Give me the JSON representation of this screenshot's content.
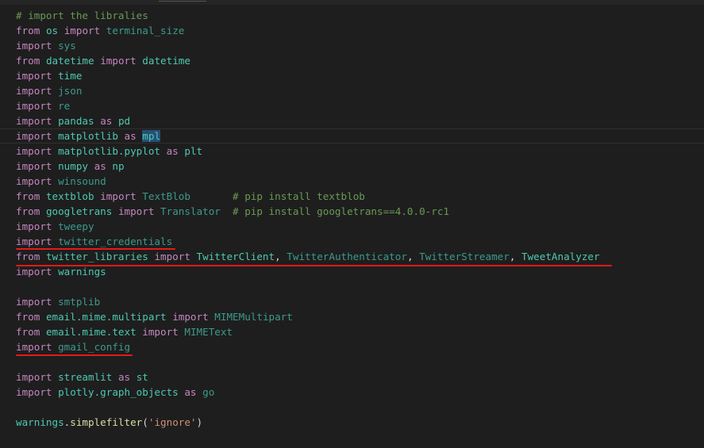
{
  "colors": {
    "background": "#1e1e1e",
    "keyword": "#c586c0",
    "module": "#4ec9b0",
    "unused": "#3c9a8c",
    "comment": "#6a9955",
    "string": "#ce9178",
    "function": "#dcdcaa",
    "variable": "#9cdcfe",
    "annotation": "#e51919"
  },
  "code": {
    "lines": [
      {
        "id": "l1",
        "tokens": [
          {
            "t": "# import the libralies",
            "c": "cm"
          }
        ]
      },
      {
        "id": "l2",
        "tokens": [
          {
            "t": "from",
            "c": "kw"
          },
          {
            "t": " ",
            "c": "plain"
          },
          {
            "t": "os",
            "c": "mod"
          },
          {
            "t": " ",
            "c": "plain"
          },
          {
            "t": "import",
            "c": "kw"
          },
          {
            "t": " ",
            "c": "plain"
          },
          {
            "t": "terminal_size",
            "c": "dim"
          }
        ]
      },
      {
        "id": "l3",
        "tokens": [
          {
            "t": "import",
            "c": "kw"
          },
          {
            "t": " ",
            "c": "plain"
          },
          {
            "t": "sys",
            "c": "dim"
          }
        ]
      },
      {
        "id": "l4",
        "tokens": [
          {
            "t": "from",
            "c": "kw"
          },
          {
            "t": " ",
            "c": "plain"
          },
          {
            "t": "datetime",
            "c": "mod"
          },
          {
            "t": " ",
            "c": "plain"
          },
          {
            "t": "import",
            "c": "kw"
          },
          {
            "t": " ",
            "c": "plain"
          },
          {
            "t": "datetime",
            "c": "mod"
          }
        ]
      },
      {
        "id": "l5",
        "tokens": [
          {
            "t": "import",
            "c": "kw"
          },
          {
            "t": " ",
            "c": "plain"
          },
          {
            "t": "time",
            "c": "mod"
          }
        ]
      },
      {
        "id": "l6",
        "tokens": [
          {
            "t": "import",
            "c": "kw"
          },
          {
            "t": " ",
            "c": "plain"
          },
          {
            "t": "json",
            "c": "dim"
          }
        ]
      },
      {
        "id": "l7",
        "tokens": [
          {
            "t": "import",
            "c": "kw"
          },
          {
            "t": " ",
            "c": "plain"
          },
          {
            "t": "re",
            "c": "dim"
          }
        ]
      },
      {
        "id": "l8",
        "tokens": [
          {
            "t": "import",
            "c": "kw"
          },
          {
            "t": " ",
            "c": "plain"
          },
          {
            "t": "pandas",
            "c": "mod"
          },
          {
            "t": " ",
            "c": "plain"
          },
          {
            "t": "as",
            "c": "kw"
          },
          {
            "t": " ",
            "c": "plain"
          },
          {
            "t": "pd",
            "c": "mod"
          }
        ]
      },
      {
        "id": "l9",
        "current": true,
        "tokens": [
          {
            "t": "import",
            "c": "kw"
          },
          {
            "t": " ",
            "c": "plain"
          },
          {
            "t": "matplotlib",
            "c": "mod"
          },
          {
            "t": " ",
            "c": "plain"
          },
          {
            "t": "as",
            "c": "kw"
          },
          {
            "t": " ",
            "c": "plain"
          },
          {
            "t": "mpl",
            "c": "mod hl"
          }
        ]
      },
      {
        "id": "l10",
        "tokens": [
          {
            "t": "import",
            "c": "kw"
          },
          {
            "t": " ",
            "c": "plain"
          },
          {
            "t": "matplotlib.pyplot",
            "c": "mod"
          },
          {
            "t": " ",
            "c": "plain"
          },
          {
            "t": "as",
            "c": "kw"
          },
          {
            "t": " ",
            "c": "plain"
          },
          {
            "t": "plt",
            "c": "mod"
          }
        ]
      },
      {
        "id": "l11",
        "tokens": [
          {
            "t": "import",
            "c": "kw"
          },
          {
            "t": " ",
            "c": "plain"
          },
          {
            "t": "numpy",
            "c": "mod"
          },
          {
            "t": " ",
            "c": "plain"
          },
          {
            "t": "as",
            "c": "kw"
          },
          {
            "t": " ",
            "c": "plain"
          },
          {
            "t": "np",
            "c": "mod"
          }
        ]
      },
      {
        "id": "l12",
        "tokens": [
          {
            "t": "import",
            "c": "kw"
          },
          {
            "t": " ",
            "c": "plain"
          },
          {
            "t": "winsound",
            "c": "dim"
          }
        ]
      },
      {
        "id": "l13",
        "tokens": [
          {
            "t": "from",
            "c": "kw"
          },
          {
            "t": " ",
            "c": "plain"
          },
          {
            "t": "textblob",
            "c": "mod"
          },
          {
            "t": " ",
            "c": "plain"
          },
          {
            "t": "import",
            "c": "kw"
          },
          {
            "t": " ",
            "c": "plain"
          },
          {
            "t": "TextBlob",
            "c": "dim"
          },
          {
            "t": "       ",
            "c": "plain"
          },
          {
            "t": "# pip install textblob",
            "c": "cm"
          }
        ]
      },
      {
        "id": "l14",
        "tokens": [
          {
            "t": "from",
            "c": "kw"
          },
          {
            "t": " ",
            "c": "plain"
          },
          {
            "t": "googletrans",
            "c": "mod"
          },
          {
            "t": " ",
            "c": "plain"
          },
          {
            "t": "import",
            "c": "kw"
          },
          {
            "t": " ",
            "c": "plain"
          },
          {
            "t": "Translator",
            "c": "dim"
          },
          {
            "t": "  ",
            "c": "plain"
          },
          {
            "t": "# pip install googletrans==4.0.0-rc1",
            "c": "cm"
          }
        ]
      },
      {
        "id": "l15",
        "tokens": [
          {
            "t": "import",
            "c": "kw"
          },
          {
            "t": " ",
            "c": "plain"
          },
          {
            "t": "tweepy",
            "c": "dim"
          }
        ]
      },
      {
        "id": "l16",
        "tokens": [
          {
            "t": "import",
            "c": "kw"
          },
          {
            "t": " ",
            "c": "plain"
          },
          {
            "t": "twitter_credentials",
            "c": "dim"
          }
        ]
      },
      {
        "id": "l17",
        "tokens": [
          {
            "t": "from",
            "c": "kw"
          },
          {
            "t": " ",
            "c": "plain"
          },
          {
            "t": "twitter_libraries",
            "c": "mod"
          },
          {
            "t": " ",
            "c": "plain"
          },
          {
            "t": "import",
            "c": "kw"
          },
          {
            "t": " ",
            "c": "plain"
          },
          {
            "t": "TwitterClient",
            "c": "mod"
          },
          {
            "t": ", ",
            "c": "plain"
          },
          {
            "t": "TwitterAuthenticator",
            "c": "dim"
          },
          {
            "t": ", ",
            "c": "plain"
          },
          {
            "t": "TwitterStreamer",
            "c": "dim"
          },
          {
            "t": ", ",
            "c": "plain"
          },
          {
            "t": "TweetAnalyzer",
            "c": "mod"
          }
        ]
      },
      {
        "id": "l18",
        "tokens": [
          {
            "t": "import",
            "c": "kw"
          },
          {
            "t": " ",
            "c": "plain"
          },
          {
            "t": "warnings",
            "c": "mod"
          }
        ]
      },
      {
        "id": "l19",
        "tokens": []
      },
      {
        "id": "l20",
        "tokens": [
          {
            "t": "import",
            "c": "kw"
          },
          {
            "t": " ",
            "c": "plain"
          },
          {
            "t": "smtplib",
            "c": "dim"
          }
        ]
      },
      {
        "id": "l21",
        "tokens": [
          {
            "t": "from",
            "c": "kw"
          },
          {
            "t": " ",
            "c": "plain"
          },
          {
            "t": "email.mime.multipart",
            "c": "mod"
          },
          {
            "t": " ",
            "c": "plain"
          },
          {
            "t": "import",
            "c": "kw"
          },
          {
            "t": " ",
            "c": "plain"
          },
          {
            "t": "MIMEMultipart",
            "c": "dim"
          }
        ]
      },
      {
        "id": "l22",
        "tokens": [
          {
            "t": "from",
            "c": "kw"
          },
          {
            "t": " ",
            "c": "plain"
          },
          {
            "t": "email.mime.text",
            "c": "mod"
          },
          {
            "t": " ",
            "c": "plain"
          },
          {
            "t": "import",
            "c": "kw"
          },
          {
            "t": " ",
            "c": "plain"
          },
          {
            "t": "MIMEText",
            "c": "dim"
          }
        ]
      },
      {
        "id": "l23",
        "tokens": [
          {
            "t": "import",
            "c": "kw"
          },
          {
            "t": " ",
            "c": "plain"
          },
          {
            "t": "gmail_config",
            "c": "dim"
          }
        ]
      },
      {
        "id": "l24",
        "tokens": []
      },
      {
        "id": "l25",
        "tokens": [
          {
            "t": "import",
            "c": "kw"
          },
          {
            "t": " ",
            "c": "plain"
          },
          {
            "t": "streamlit",
            "c": "mod"
          },
          {
            "t": " ",
            "c": "plain"
          },
          {
            "t": "as",
            "c": "kw"
          },
          {
            "t": " ",
            "c": "plain"
          },
          {
            "t": "st",
            "c": "mod"
          }
        ]
      },
      {
        "id": "l26",
        "tokens": [
          {
            "t": "import",
            "c": "kw"
          },
          {
            "t": " ",
            "c": "plain"
          },
          {
            "t": "plotly.graph_objects",
            "c": "mod"
          },
          {
            "t": " ",
            "c": "plain"
          },
          {
            "t": "as",
            "c": "kw"
          },
          {
            "t": " ",
            "c": "plain"
          },
          {
            "t": "go",
            "c": "dim"
          }
        ]
      },
      {
        "id": "l27",
        "tokens": []
      },
      {
        "id": "l28",
        "tokens": [
          {
            "t": "warnings",
            "c": "mod"
          },
          {
            "t": ".",
            "c": "plain"
          },
          {
            "t": "simplefilter",
            "c": "fn"
          },
          {
            "t": "(",
            "c": "plain"
          },
          {
            "t": "'ignore'",
            "c": "str"
          },
          {
            "t": ")",
            "c": "plain"
          }
        ]
      }
    ]
  }
}
